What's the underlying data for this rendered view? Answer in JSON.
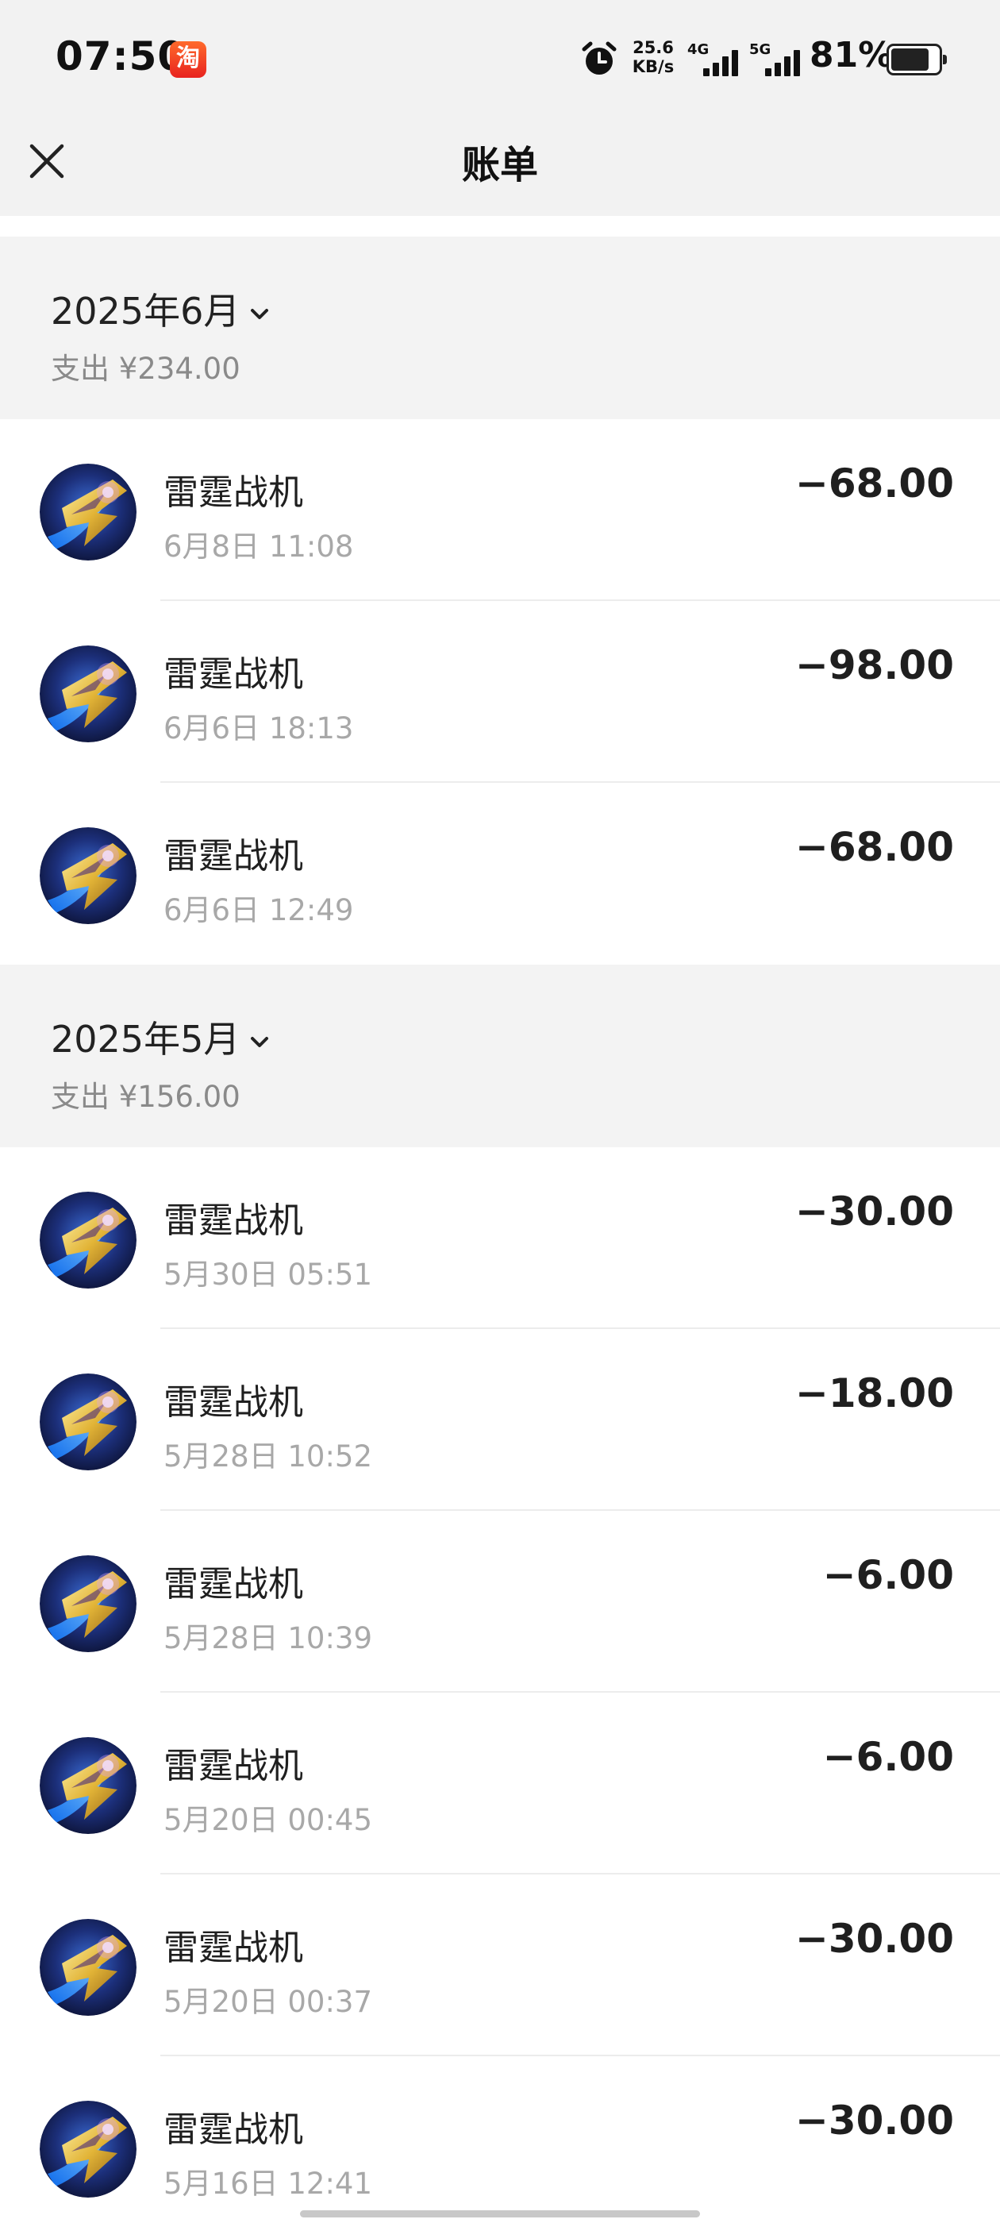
{
  "status_bar": {
    "time": "07:50",
    "app_badge": "淘",
    "net_speed_value": "25.6",
    "net_speed_unit": "KB/s",
    "signal_1": "4G",
    "signal_2": "5G",
    "battery": "81%",
    "battery_level": 0.81,
    "icons": [
      "taobao-icon",
      "alarm-icon",
      "signal-4g-icon",
      "signal-5g-icon",
      "battery-icon"
    ]
  },
  "header": {
    "title": "账单",
    "close_icon": "close-icon"
  },
  "months": [
    {
      "title": "2025年6月",
      "summary": "支出 ¥234.00",
      "transactions": [
        {
          "name": "雷霆战机",
          "time": "6月8日 11:08",
          "amount": "−68.00"
        },
        {
          "name": "雷霆战机",
          "time": "6月6日 18:13",
          "amount": "−98.00"
        },
        {
          "name": "雷霆战机",
          "time": "6月6日 12:49",
          "amount": "−68.00"
        }
      ]
    },
    {
      "title": "2025年5月",
      "summary": "支出 ¥156.00",
      "transactions": [
        {
          "name": "雷霆战机",
          "time": "5月30日 05:51",
          "amount": "−30.00"
        },
        {
          "name": "雷霆战机",
          "time": "5月28日 10:52",
          "amount": "−18.00"
        },
        {
          "name": "雷霆战机",
          "time": "5月28日 10:39",
          "amount": "−6.00"
        },
        {
          "name": "雷霆战机",
          "time": "5月20日 00:45",
          "amount": "−6.00"
        },
        {
          "name": "雷霆战机",
          "time": "5月20日 00:37",
          "amount": "−30.00"
        },
        {
          "name": "雷霆战机",
          "time": "5月16日 12:41",
          "amount": "−30.00"
        }
      ]
    }
  ]
}
